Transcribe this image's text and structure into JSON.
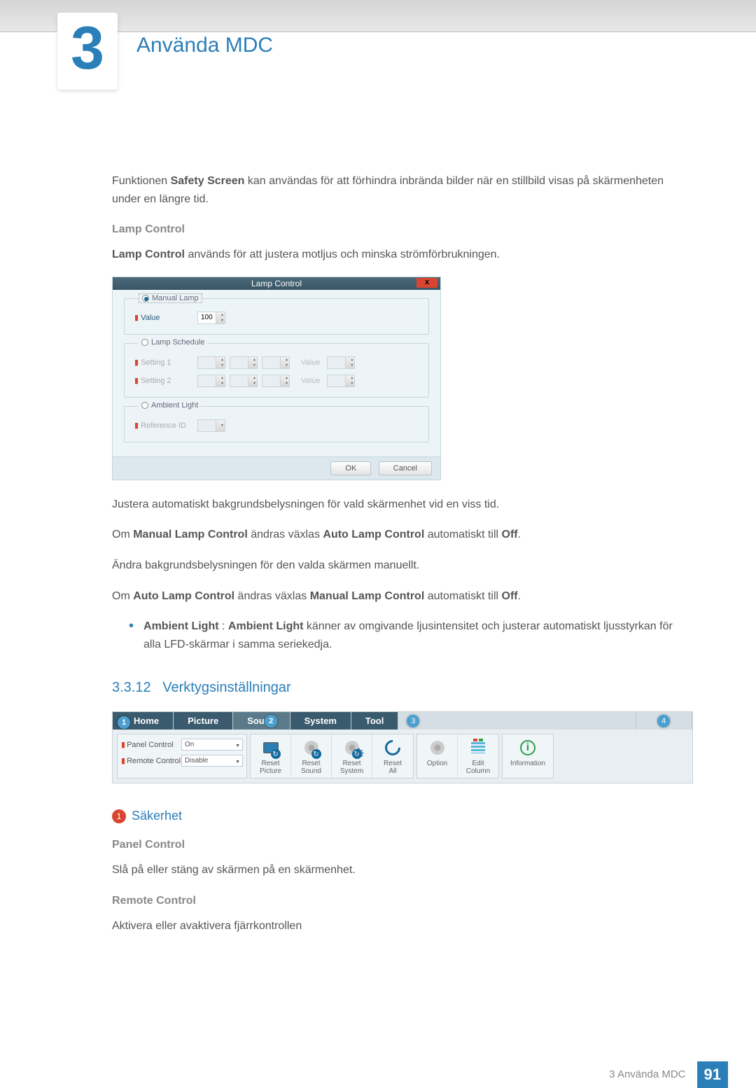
{
  "chapter": {
    "number": "3",
    "title": "Använda MDC"
  },
  "intro": {
    "safety_pre": "Funktionen ",
    "safety_bold": "Safety Screen",
    "safety_post": " kan användas för att förhindra inbrända bilder när en stillbild visas på skärmenheten under en längre tid."
  },
  "lamp": {
    "heading": "Lamp Control",
    "desc_bold": "Lamp Control",
    "desc_post": " används för att justera motljus och minska strömförbrukningen.",
    "dialog": {
      "title": "Lamp Control",
      "close": "x",
      "manual": {
        "legend": "Manual Lamp",
        "value_label": "Value",
        "value": "100"
      },
      "schedule": {
        "legend": "Lamp Schedule",
        "setting1": "Setting 1",
        "setting2": "Setting 2",
        "value_text": "Value"
      },
      "ambient": {
        "legend": "Ambient Light",
        "ref_label": "Reference ID"
      },
      "ok": "OK",
      "cancel": "Cancel"
    },
    "p_auto": "Justera automatiskt bakgrundsbelysningen för vald skärmenhet vid en viss tid.",
    "p_manual_pre": "Om ",
    "p_manual_b1": "Manual Lamp Control",
    "p_manual_mid": " ändras växlas ",
    "p_manual_b2": "Auto Lamp Control",
    "p_manual_mid2": " automatiskt till ",
    "p_manual_b3": "Off",
    "p_change": "Ändra bakgrundsbelysningen för den valda skärmen manuellt.",
    "p_auto2_pre": "Om ",
    "p_auto2_b1": "Auto Lamp Control",
    "p_auto2_mid": " ändras växlas ",
    "p_auto2_b2": "Manual Lamp Control",
    "p_auto2_mid2": " automatiskt till ",
    "p_auto2_b3": "Off",
    "bullet_b1": "Ambient Light",
    "bullet_sep": " : ",
    "bullet_b2": "Ambient Light",
    "bullet_post": " känner av omgivande ljusintensitet och justerar automatiskt ljusstyrkan för alla LFD-skärmar i samma seriekedja."
  },
  "section": {
    "number": "3.3.12",
    "title": "Verktygsinställningar"
  },
  "toolbar": {
    "tabs": {
      "home": "Home",
      "picture": "Picture",
      "sound": "Sound",
      "system": "System",
      "tool": "Tool"
    },
    "callouts": {
      "c1": "1",
      "c2": "2",
      "c3": "3",
      "c4": "4"
    },
    "panel_control": {
      "label": "Panel Control",
      "value": "On"
    },
    "remote_control": {
      "label": "Remote Control",
      "value": "Disable"
    },
    "buttons": {
      "reset_picture": "Reset\nPicture",
      "reset_sound": "Reset\nSound",
      "reset_system": "Reset\nSystem",
      "reset_all": "Reset\nAll",
      "option": "Option",
      "edit_column": "Edit\nColumn",
      "information": "Information"
    }
  },
  "security": {
    "badge": "1",
    "heading": "Säkerhet",
    "panel_heading": "Panel Control",
    "panel_desc": "Slå på eller stäng av skärmen på en skärmenhet.",
    "remote_heading": "Remote Control",
    "remote_desc": "Aktivera eller avaktivera fjärrkontrollen"
  },
  "footer": {
    "text": "3 Använda MDC",
    "page": "91"
  }
}
